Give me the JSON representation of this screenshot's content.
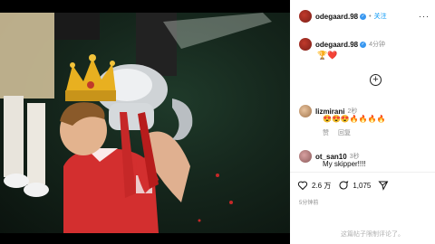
{
  "post": {
    "username": "odegaard.98",
    "follow_label": "关注",
    "more_icon": "more-icon",
    "caption_username": "odegaard.98",
    "caption_time": "4分钟",
    "caption_emojis": "🏆❤️"
  },
  "comments": [
    {
      "username": "lizmirani",
      "time": "2秒",
      "text": "😍😍😍🔥🔥🔥🔥",
      "like_label": "赞",
      "reply_label": "回复"
    },
    {
      "username": "ot_san10",
      "time": "3秒",
      "text": "My skipper!!!!"
    }
  ],
  "actions": {
    "likes": "2.6 万",
    "comments": "1,075"
  },
  "posted_time": "5分钟前",
  "notice": "这篇帖子限制评论了。",
  "colors": {
    "accent": "#0095f6",
    "verified": "#3897f0",
    "arsenal_red": "#d32f2f"
  }
}
